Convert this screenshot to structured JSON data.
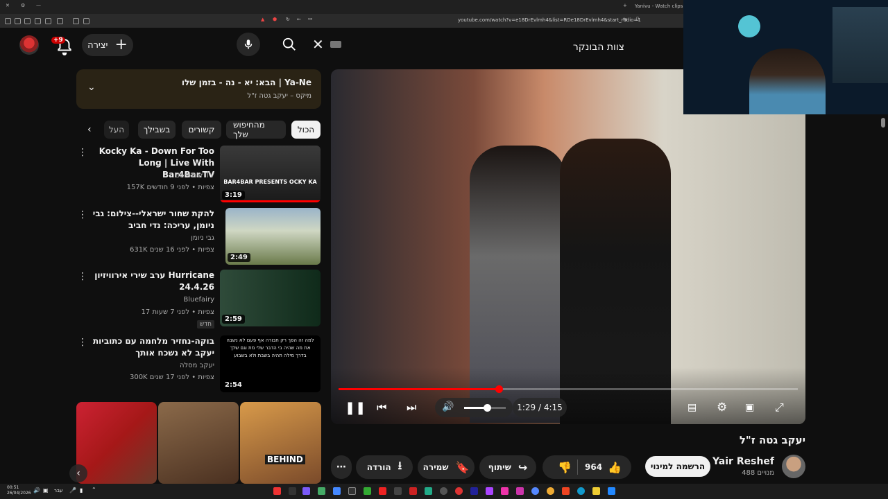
{
  "browser": {
    "tab_title": "Yanivu - Watch clips on Kic",
    "url": "youtube.com/watch?v=e18DrEvlmh4&list=RDe18DrEvlmh4&start_radio=1"
  },
  "header": {
    "notification_count": "+9",
    "create_label": "יצירה",
    "search_query": "צוות הבונקר",
    "clear_icon": "close-icon",
    "mic_icon": "mic-icon",
    "search_icon": "search-icon"
  },
  "up_next": {
    "title": "הבא: יא - נה - בזמן שלו | Ya-Ne",
    "subtitle": "מיקס – יעקב גטה ז\"ל"
  },
  "chips": [
    "הכול",
    "מהחיפוש שלך",
    "קשורים",
    "בשבילך",
    "העל"
  ],
  "recommendations": [
    {
      "title": "Kocky Ka - Down For Too Long | Live With Bar4Bar.TV",
      "channel": "Bar4Bar TV",
      "meta": "157K צפיות • לפני 9 חודשים",
      "duration": "3:19",
      "thumb_text": "BAR4BAR PRESENTS OCKY KA"
    },
    {
      "title": "להקת שחור ישראלי--צילום: גבי ניומן, עריכה: נדי חביב",
      "channel": "גבי ניומן",
      "meta": "631K צפיות • לפני 16 שנים",
      "duration": "2:49"
    },
    {
      "title": "ערב שירי אירוויזיון Hurricane 24.4.26",
      "channel": "Bluefairy",
      "meta": "17 צפיות • לפני 7 שעות",
      "badge": "חדש",
      "duration": "2:59"
    },
    {
      "title": "בוקה-נחזיר מלחמה עם כתוביות יעקב לא נשכח אותך",
      "channel": "יעקב מסלה",
      "meta": "300K צפיות • לפני 17 שנים",
      "duration": "2:54",
      "thumb_text": "למה זה הפך רק חבורה אף פעם לא נשבה את מה שהיה בי הדבר שלי מת וגם שלך בדרך מילה תהיה בשבת ולא בשבוע"
    }
  ],
  "shorts_label": "BEHIND",
  "player": {
    "time": "1:29 / 4:15",
    "progress": 0.349,
    "volume": 0.55
  },
  "video": {
    "title": "יעקב גטה ז\"ל",
    "channel": "Yair Reshef",
    "subscribers": "488 מנויים",
    "subscribe_label": "הרשמה למינוי",
    "like_count": "964",
    "share_label": "שיתוף",
    "save_label": "שמירה",
    "download_label": "הורדה"
  },
  "taskbar": {
    "time": "00:51",
    "date": "26/04/2026",
    "lang": "עבר"
  },
  "colors": {
    "accent": "#ff0000",
    "bg": "#0f0f0f",
    "chip_bg": "#272727"
  }
}
